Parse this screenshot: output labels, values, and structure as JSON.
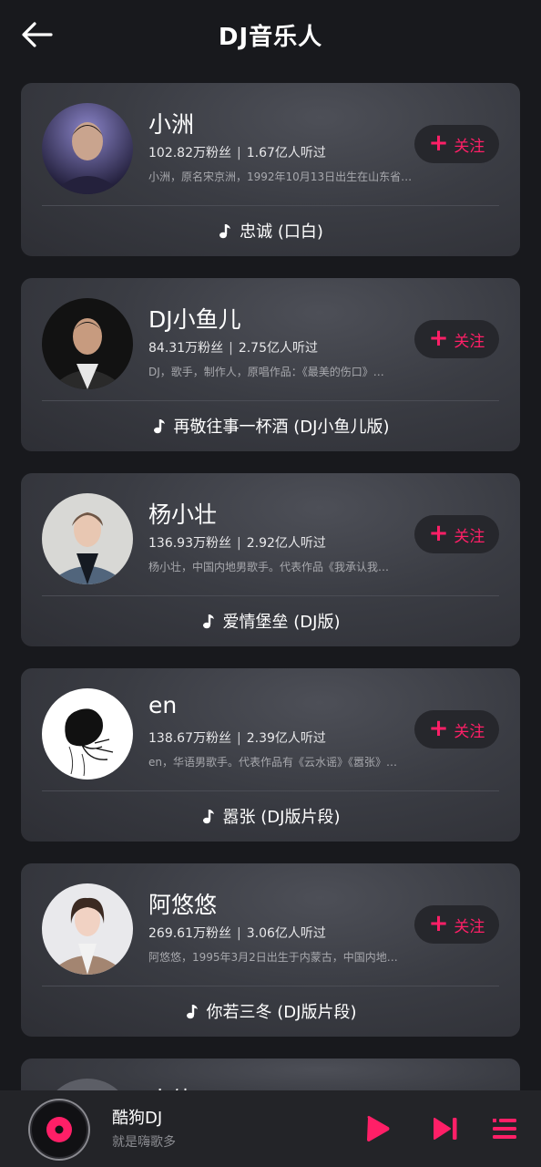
{
  "header": {
    "title": "DJ音乐人",
    "back_icon": "arrow-left-icon"
  },
  "artists": [
    {
      "name": "小洲",
      "fans": "102.82万粉丝",
      "plays": "1.67亿人听过",
      "bio": "小洲，原名宋京洲，1992年10月13日出生在山东省…",
      "follow_label": "关注",
      "song": "忠诚 (口白)"
    },
    {
      "name": "DJ小鱼儿",
      "fans": "84.31万粉丝",
      "plays": "2.75亿人听过",
      "bio": "DJ，歌手，制作人，原唱作品：《最美的伤口》…",
      "follow_label": "关注",
      "song": "再敬往事一杯酒 (DJ小鱼儿版)"
    },
    {
      "name": "杨小壮",
      "fans": "136.93万粉丝",
      "plays": "2.92亿人听过",
      "bio": "杨小壮，中国内地男歌手。代表作品《我承认我…",
      "follow_label": "关注",
      "song": "爱情堡垒 (DJ版)"
    },
    {
      "name": "en",
      "fans": "138.67万粉丝",
      "plays": "2.39亿人听过",
      "bio": "en，华语男歌手。代表作品有《云水谣》《嚣张》…",
      "follow_label": "关注",
      "song": "嚣张 (DJ版片段)"
    },
    {
      "name": "阿悠悠",
      "fans": "269.61万粉丝",
      "plays": "3.06亿人听过",
      "bio": "阿悠悠，1995年3月2日出生于内蒙古，中国内地…",
      "follow_label": "关注",
      "song": "你若三冬 (DJ版片段)"
    }
  ],
  "partial_artist": {
    "name": "小倩"
  },
  "player": {
    "title": "酷狗DJ",
    "subtitle": "就是嗨歌多",
    "icons": [
      "vinyl-disc-icon",
      "play-icon",
      "next-track-icon",
      "playlist-icon"
    ]
  },
  "colors": {
    "accent": "#ff1f67",
    "background": "#18191d",
    "card": "#3a3c43"
  }
}
